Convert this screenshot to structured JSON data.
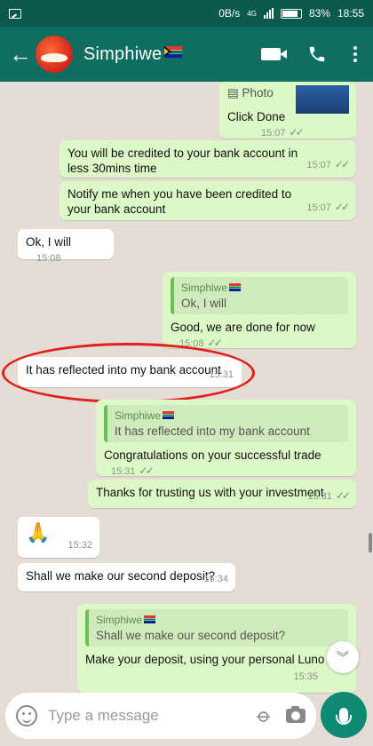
{
  "statusbar": {
    "data_speed": "0B/s",
    "network": "4G",
    "battery": "83%",
    "time": "18:55"
  },
  "header": {
    "contact_name": "Simphiwe"
  },
  "messages": {
    "m1": {
      "label": "Photo",
      "text": "Click Done",
      "time": "15:07"
    },
    "m2": {
      "text": "You will be credited to your bank account in less 30mins time",
      "time": "15:07"
    },
    "m3": {
      "text": "Notify me when you have been credited to your bank account",
      "time": "15:07"
    },
    "m4": {
      "text": "Ok, I will",
      "time": "15:08"
    },
    "m5": {
      "quote_name": "Simphiwe",
      "quote_text": "Ok, I will",
      "text": "Good, we are done for now",
      "time": "15:08"
    },
    "m6": {
      "text": "It has reflected into my bank account",
      "time": "15:31"
    },
    "m7": {
      "quote_name": "Simphiwe",
      "quote_text": "It has reflected into my bank account",
      "text": "Congratulations on your successful trade",
      "time": "15:31"
    },
    "m8": {
      "text": "Thanks for trusting us with your investment",
      "time": "15:31"
    },
    "m9": {
      "emoji": "🙏",
      "time": "15:32"
    },
    "m10": {
      "text": "Shall we make our second deposit?",
      "time": "15:34"
    },
    "m11": {
      "quote_name": "Simphiwe",
      "quote_text": "Shall we make our second deposit?",
      "text": "Make your deposit, using your personal Luno deposit",
      "time": "15:35"
    }
  },
  "input": {
    "placeholder": "Type a message"
  },
  "colors": {
    "header": "#0f6e5f",
    "outgoing": "#dcf8c6",
    "incoming": "#ffffff",
    "annotation": "#e0201a"
  }
}
